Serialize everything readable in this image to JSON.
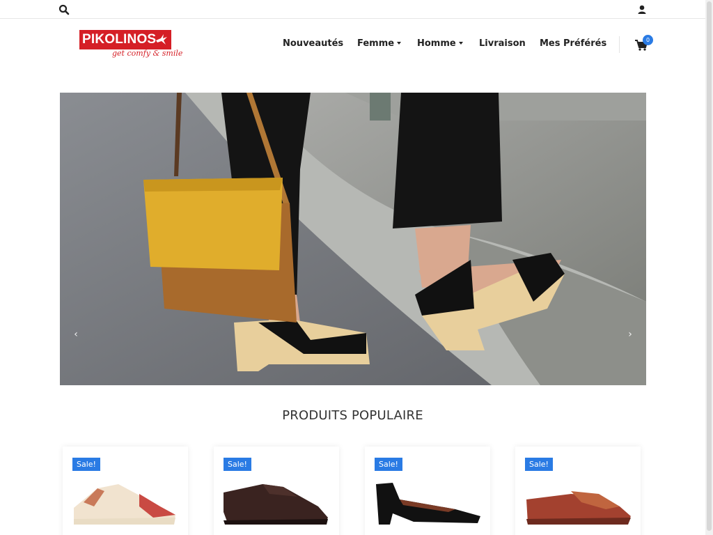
{
  "topbar": {
    "search_icon": "search-icon",
    "user_icon": "user-icon"
  },
  "header": {
    "brand": "PIKOLINOS",
    "tagline": "get comfy & smile",
    "nav": [
      {
        "label": "Nouveautés",
        "dropdown": false
      },
      {
        "label": "Femme",
        "dropdown": true
      },
      {
        "label": "Homme",
        "dropdown": true
      },
      {
        "label": "Livraison",
        "dropdown": false
      },
      {
        "label": "Mes Préférés",
        "dropdown": false
      }
    ],
    "cart_count": "0"
  },
  "hero": {
    "prev_arrow": "‹",
    "next_arrow": "›"
  },
  "popular": {
    "title": "PRODUITS POPULAIRE",
    "products": [
      {
        "badge": "Sale!",
        "icon": "sneaker-icon"
      },
      {
        "badge": "Sale!",
        "icon": "derby-shoe-icon"
      },
      {
        "badge": "Sale!",
        "icon": "pump-shoe-icon"
      },
      {
        "badge": "Sale!",
        "icon": "loafer-icon"
      }
    ]
  },
  "colors": {
    "brand_red": "#d51f26",
    "accent_blue": "#2a7be4"
  }
}
